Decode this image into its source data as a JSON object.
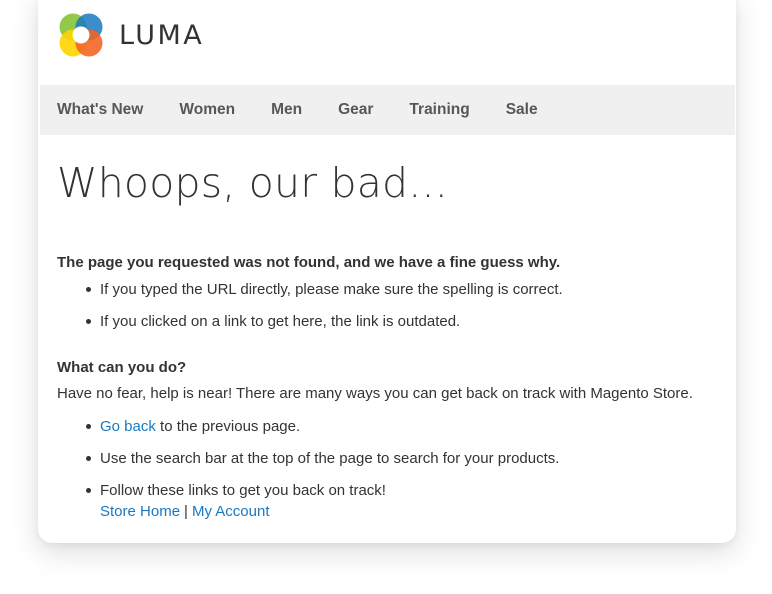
{
  "header": {
    "logo_text": "LUMA",
    "logo_colors": [
      "#f26322",
      "#ffd400",
      "#1979c3",
      "#8dc63f"
    ]
  },
  "nav": {
    "items": [
      {
        "label": "What's New"
      },
      {
        "label": "Women"
      },
      {
        "label": "Men"
      },
      {
        "label": "Gear"
      },
      {
        "label": "Training"
      },
      {
        "label": "Sale"
      }
    ]
  },
  "content": {
    "title": "Whoops, our bad...",
    "lead": "The page you requested was not found, and we have a fine guess why.",
    "reasons": [
      "If you typed the URL directly, please make sure the spelling is correct.",
      "If you clicked on a link to get here, the link is outdated."
    ],
    "subhead": "What can you do?",
    "intro": "Have no fear, help is near! There are many ways you can get back on track with Magento Store.",
    "suggestions": {
      "go_back_link": "Go back",
      "go_back_rest": " to the previous page.",
      "search_text": "Use the search bar at the top of the page to search for your products.",
      "follow_text": "Follow these links to get you back on track!",
      "store_home_link": "Store Home",
      "separator": "|",
      "my_account_link": "My Account"
    },
    "link_color": "#1979c3"
  }
}
